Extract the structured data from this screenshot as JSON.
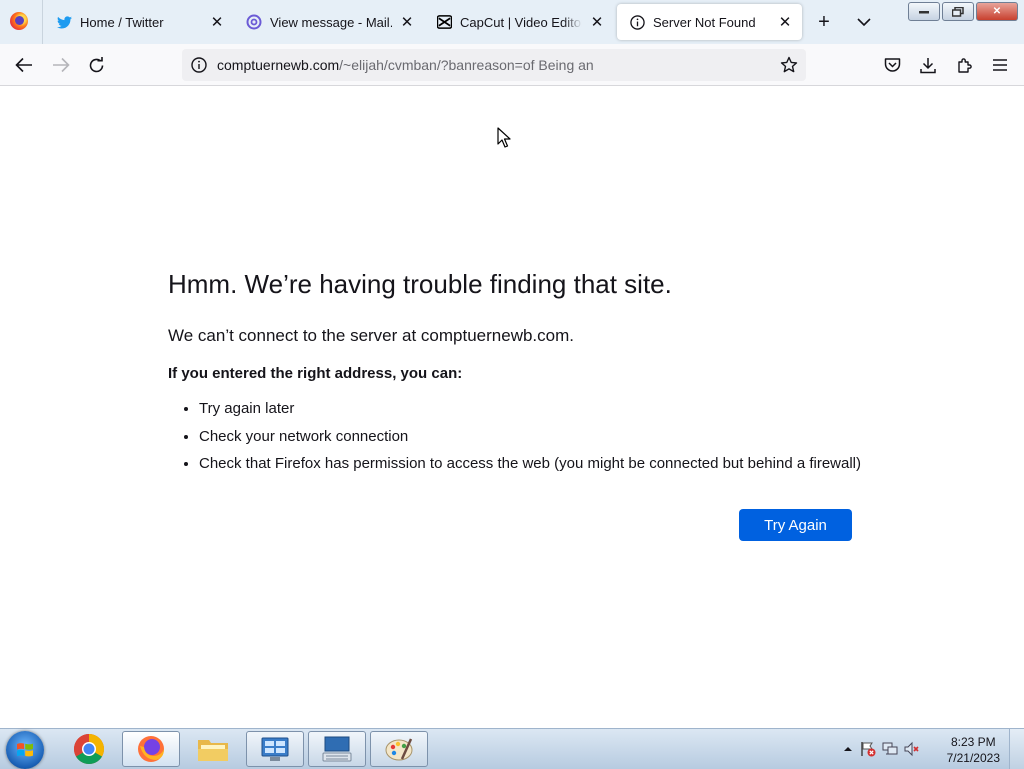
{
  "browser": {
    "tabs": [
      {
        "title": "Home / Twitter",
        "icon": "twitter-icon",
        "active": false
      },
      {
        "title": "View message - Mail.tm",
        "icon": "mailtm-icon",
        "active": false
      },
      {
        "title": "CapCut | Video Editor | All-In-One",
        "icon": "capcut-icon",
        "active": false
      },
      {
        "title": "Server Not Found",
        "icon": "info-icon",
        "active": true
      }
    ],
    "url_host": "comptuernewb.com",
    "url_path": "/~elijah/cvmban/?banreason=of Being an"
  },
  "error_page": {
    "title": "Hmm. We’re having trouble finding that site.",
    "description": "We can’t connect to the server at comptuernewb.com.",
    "subtitle": "If you entered the right address, you can:",
    "suggestions": [
      "Try again later",
      "Check your network connection",
      "Check that Firefox has permission to access the web (you might be connected but behind a firewall)"
    ],
    "try_again_label": "Try Again"
  },
  "taskbar": {
    "clock_time": "8:23 PM",
    "clock_date": "7/21/2023",
    "apps": [
      "chrome-icon",
      "firefox-icon",
      "file-explorer-icon",
      "control-panel-icon",
      "keyboard-icon",
      "paint-icon"
    ]
  },
  "colors": {
    "tabstrip_bg": "#e6eff7",
    "accent_button": "#0061e0",
    "twitter_blue": "#1d9bf0",
    "mailtm_purple": "#6b5bd6"
  }
}
